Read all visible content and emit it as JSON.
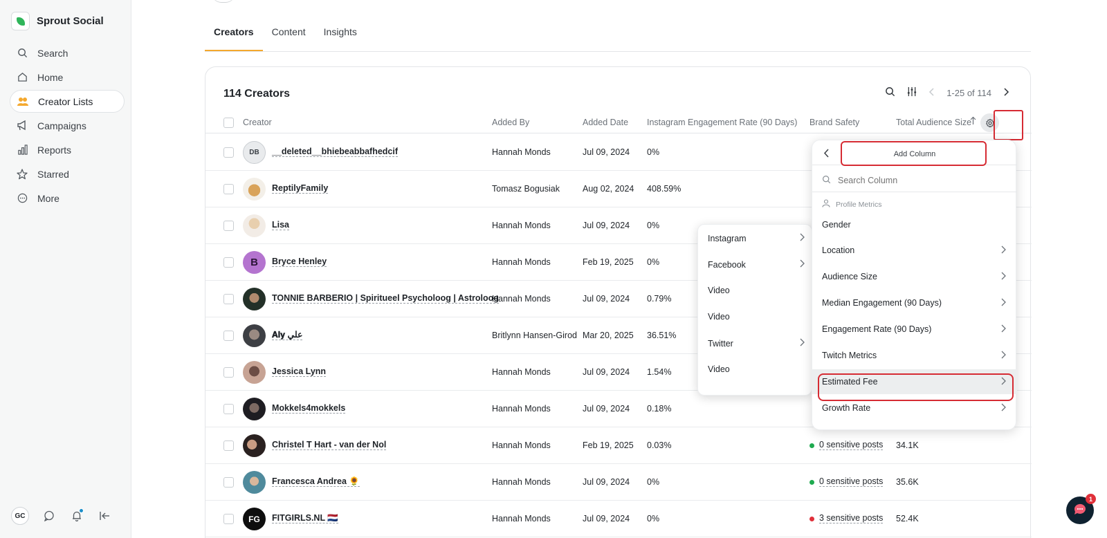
{
  "brand": {
    "name": "Sprout Social"
  },
  "nav": [
    {
      "label": "Search",
      "icon": "search-icon"
    },
    {
      "label": "Home",
      "icon": "home-icon"
    },
    {
      "label": "Creator Lists",
      "icon": "users-icon",
      "active": true
    },
    {
      "label": "Campaigns",
      "icon": "megaphone-icon"
    },
    {
      "label": "Reports",
      "icon": "bar-chart-icon"
    },
    {
      "label": "Starred",
      "icon": "star-icon"
    },
    {
      "label": "More",
      "icon": "more-icon"
    }
  ],
  "user": {
    "initials": "GC"
  },
  "tabs": [
    "Creators",
    "Content",
    "Insights"
  ],
  "card": {
    "title": "114 Creators",
    "pagination": "1-25 of 114"
  },
  "columns": {
    "creator": "Creator",
    "added_by": "Added By",
    "added_date": "Added Date",
    "engagement": "Instagram Engagement Rate (90 Days)",
    "brand_safety": "Brand Safety",
    "audience": "Total Audience Size"
  },
  "rows": [
    {
      "initials": "DB",
      "name": "__deleted__bhiebeabbafhedcif",
      "added_by": "Hannah Monds",
      "date": "Jul 09, 2024",
      "eng": "0%",
      "safety": "",
      "size": ""
    },
    {
      "initials": "",
      "name": "ReptilyFamily",
      "added_by": "Tomasz Bogusiak",
      "date": "Aug 02, 2024",
      "eng": "408.59%",
      "safety": "",
      "size": ""
    },
    {
      "initials": "",
      "name": "Lisa",
      "added_by": "Hannah Monds",
      "date": "Jul 09, 2024",
      "eng": "0%",
      "safety": "",
      "size": ""
    },
    {
      "initials": "B",
      "name": "Bryce Henley",
      "added_by": "Hannah Monds",
      "date": "Feb 19, 2025",
      "eng": "0%",
      "safety": "",
      "size": ""
    },
    {
      "initials": "",
      "name": "TONNIE BARBERIO | Spiritueel Psycholoog | Astroloog",
      "added_by": "Hannah Monds",
      "date": "Jul 09, 2024",
      "eng": "0.79%",
      "safety": "",
      "size": ""
    },
    {
      "initials": "",
      "name": "𝐀𝐥𝐲 علي",
      "added_by": "Britlynn Hansen-Girod",
      "date": "Mar 20, 2025",
      "eng": "36.51%",
      "safety": "",
      "size": ""
    },
    {
      "initials": "",
      "name": "Jessica Lynn",
      "added_by": "Hannah Monds",
      "date": "Jul 09, 2024",
      "eng": "1.54%",
      "safety": "",
      "size": ""
    },
    {
      "initials": "",
      "name": "Mokkels4mokkels",
      "added_by": "Hannah Monds",
      "date": "Jul 09, 2024",
      "eng": "0.18%",
      "safety": "",
      "size": ""
    },
    {
      "initials": "",
      "name": "Christel T Hart - van der Nol",
      "added_by": "Hannah Monds",
      "date": "Feb 19, 2025",
      "eng": "0.03%",
      "safety": "0 sensitive posts",
      "safety_color": "#1faa4f",
      "size": "34.1K"
    },
    {
      "initials": "",
      "name": "Francesca Andrea 🌻",
      "added_by": "Hannah Monds",
      "date": "Jul 09, 2024",
      "eng": "0%",
      "safety": "0 sensitive posts",
      "safety_color": "#1faa4f",
      "size": "35.6K"
    },
    {
      "initials": "FG",
      "name": "FITGIRLS.NL 🇳🇱",
      "added_by": "Hannah Monds",
      "date": "Jul 09, 2024",
      "eng": "0%",
      "safety": "3 sensitive posts",
      "safety_color": "#e0303a",
      "size": "52.4K"
    }
  ],
  "submenu": [
    {
      "label": "Instagram",
      "chevron": true
    },
    {
      "label": "Facebook",
      "chevron": true
    },
    {
      "label": "Video",
      "chevron": false
    },
    {
      "label": "Video",
      "chevron": false
    },
    {
      "label": "Twitter",
      "chevron": true
    },
    {
      "label": "Video",
      "chevron": false
    }
  ],
  "column_panel": {
    "title": "Add Column",
    "search_placeholder": "Search Column",
    "section": "Profile Metrics",
    "items": [
      {
        "label": "Gender",
        "chevron": false
      },
      {
        "label": "Location",
        "chevron": true
      },
      {
        "label": "Audience Size",
        "chevron": true
      },
      {
        "label": "Median Engagement (90 Days)",
        "chevron": true
      },
      {
        "label": "Engagement Rate (90 Days)",
        "chevron": true
      },
      {
        "label": "Twitch Metrics",
        "chevron": true
      },
      {
        "label": "Estimated Fee",
        "chevron": true,
        "highlighted": true
      },
      {
        "label": "Growth Rate",
        "chevron": true
      }
    ]
  },
  "chat": {
    "badge": "1"
  },
  "colors": {
    "accent": "#f4a82e",
    "brand": "#2fb55a",
    "highlight_box": "#d62b33"
  }
}
